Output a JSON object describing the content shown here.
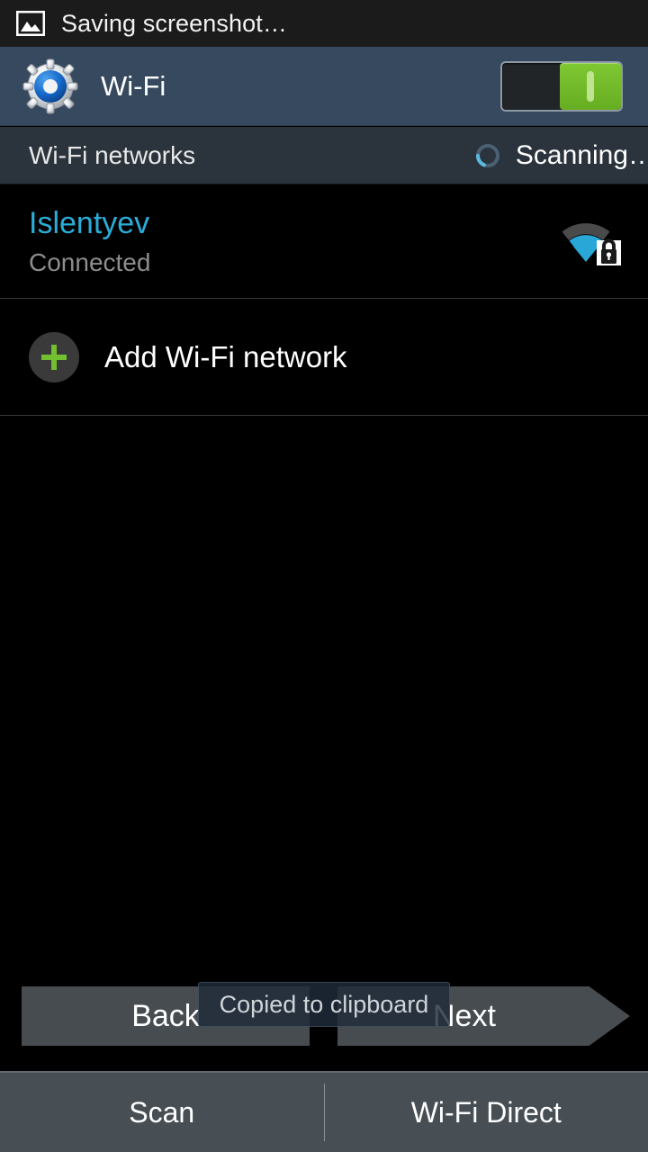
{
  "status_bar": {
    "icon": "image-screenshot-icon",
    "text": "Saving screenshot…"
  },
  "wifi_header": {
    "icon": "settings-gear-icon",
    "title": "Wi-Fi",
    "toggle": {
      "name": "wifi-toggle",
      "state": "on",
      "on_color": "#6fbb28"
    }
  },
  "networks_header": {
    "title": "Wi-Fi networks",
    "scan_status": "Scanning…",
    "spinner_icon": "loading-spinner-icon"
  },
  "networks": [
    {
      "ssid": "Islentyev",
      "status": "Connected",
      "signal_icon": "wifi-signal-secured-icon",
      "signal_bars": 3,
      "signal_bars_total": 4,
      "secured": true,
      "ssid_color": "#2badd8"
    }
  ],
  "add_network": {
    "icon": "plus-icon",
    "label": "Add Wi-Fi network",
    "icon_color": "#6fbb28"
  },
  "wizard": {
    "back_label": "Back",
    "next_label": "Next"
  },
  "toast": {
    "text": "Copied to clipboard"
  },
  "bottom_bar": {
    "scan_label": "Scan",
    "wifi_direct_label": "Wi-Fi Direct"
  }
}
